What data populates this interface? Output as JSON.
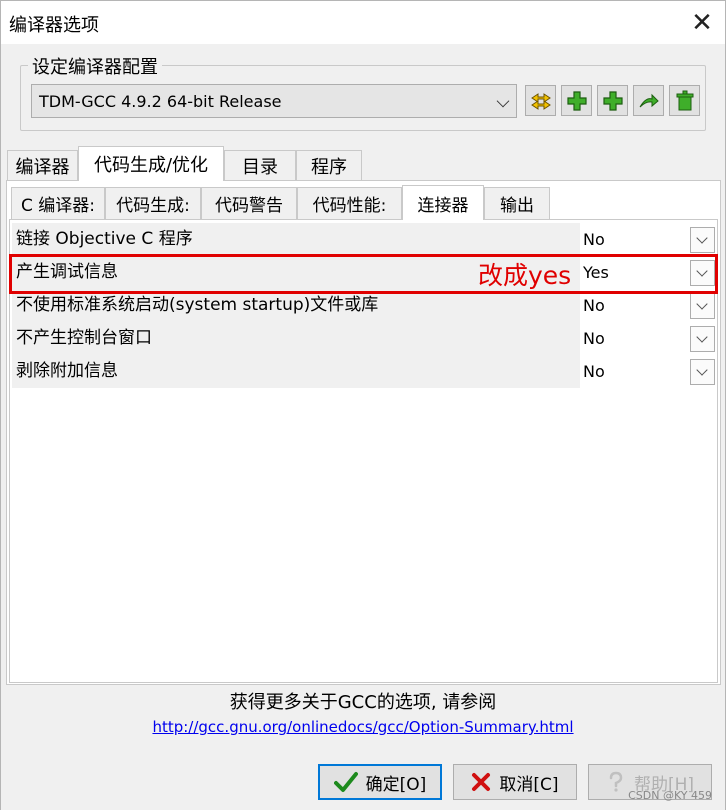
{
  "window": {
    "title": "编译器选项",
    "close_glyph": "✕"
  },
  "compiler_set": {
    "group_label": "设定编译器配置",
    "selected": "TDM-GCC 4.9.2 64-bit Release",
    "toolbar_icons": [
      "rename-icon",
      "add-icon",
      "add-blank-icon",
      "import-icon",
      "delete-icon"
    ]
  },
  "outer_tabs": [
    {
      "label": "编译器",
      "active": false
    },
    {
      "label": "代码生成/优化",
      "active": true
    },
    {
      "label": "目录",
      "active": false
    },
    {
      "label": "程序",
      "active": false
    }
  ],
  "inner_tabs": [
    {
      "label": "C 编译器:",
      "active": false
    },
    {
      "label": "代码生成:",
      "active": false
    },
    {
      "label": "代码警告",
      "active": false
    },
    {
      "label": "代码性能:",
      "active": false
    },
    {
      "label": "连接器",
      "active": true
    },
    {
      "label": "输出",
      "active": false
    }
  ],
  "options": [
    {
      "label": "链接 Objective C 程序",
      "value": "No"
    },
    {
      "label": "产生调试信息",
      "value": "Yes"
    },
    {
      "label": "不使用标准系统启动(system startup)文件或库",
      "value": "No"
    },
    {
      "label": "不产生控制台窗口",
      "value": "No"
    },
    {
      "label": "剥除附加信息",
      "value": "No"
    }
  ],
  "annotation": {
    "text": "改成yes",
    "color": "#e00000"
  },
  "info": {
    "text": "获得更多关于GCC的选项, 请参阅",
    "link": "http://gcc.gnu.org/onlinedocs/gcc/Option-Summary.html"
  },
  "buttons": {
    "ok": "确定[O]",
    "cancel": "取消[C]",
    "help": "帮助[H]"
  },
  "watermark": "CSDN @KY 459"
}
